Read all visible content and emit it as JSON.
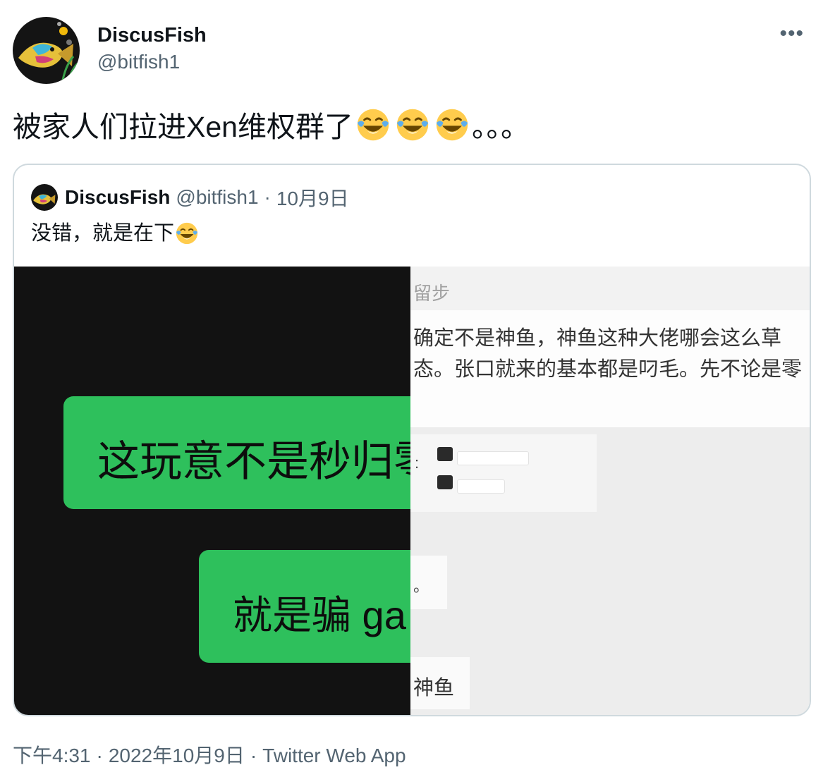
{
  "author": {
    "display_name": "DiscusFish",
    "handle": "@bitfish1",
    "avatar_icon": "discus-fish-avatar-icon"
  },
  "tweet": {
    "text": "被家人们拉进Xen维权群了",
    "emoji_icon": "face-with-tears-of-joy-icon",
    "emoji_count": 3,
    "suffix": "。。。"
  },
  "quote": {
    "display_name": "DiscusFish",
    "handle": "@bitfish1",
    "separator": "·",
    "date": "10月9日",
    "text": "没错，就是在下",
    "emoji_icon": "face-with-tears-of-joy-icon",
    "media": {
      "left_bubble_1": "这玩意不是秒归零",
      "left_bubble_2": "就是骗 ga",
      "right_header": "留步",
      "right_card_text": "确定不是神鱼，神鱼这种大佬哪会这么草态。张口就来的基本都是叼毛。先不论是零",
      "right_colon": ":",
      "right_dot": "。",
      "right_bottom": "神鱼"
    }
  },
  "meta": {
    "time": "下午4:31",
    "separator": "·",
    "date": "2022年10月9日",
    "source": "Twitter Web App"
  },
  "colors": {
    "text": "#0f1419",
    "secondary": "#536471",
    "border": "#cfd9de",
    "chat_bubble": "#2ec05c"
  }
}
